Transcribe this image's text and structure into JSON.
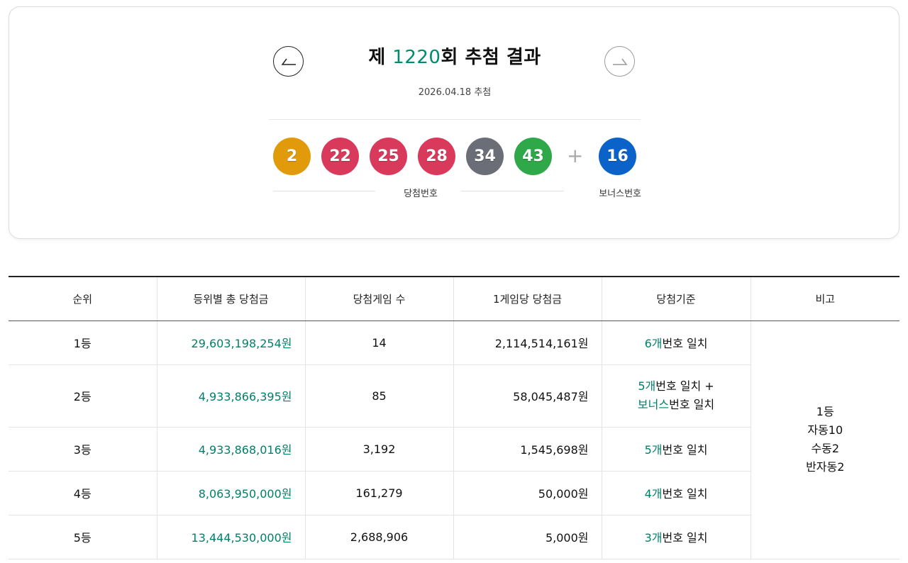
{
  "header": {
    "title_prefix": "제 ",
    "round": "1220",
    "title_suffix": "회 추첨 결과",
    "date": "2026.04.18 추첨",
    "prev_icon": "arrow-left-icon",
    "next_icon": "arrow-right-icon"
  },
  "balls": {
    "winning": [
      {
        "number": "2",
        "color": "#e09a0a"
      },
      {
        "number": "22",
        "color": "#d93a5b"
      },
      {
        "number": "25",
        "color": "#d93a5b"
      },
      {
        "number": "28",
        "color": "#d93a5b"
      },
      {
        "number": "34",
        "color": "#6b6e77"
      },
      {
        "number": "43",
        "color": "#2fa84a"
      }
    ],
    "plus": "+",
    "bonus": {
      "number": "16",
      "color": "#0b63c9"
    },
    "winning_label": "당첨번호",
    "bonus_label": "보너스번호"
  },
  "table": {
    "headers": [
      "순위",
      "등위별 총 당첨금",
      "당첨게임 수",
      "1게임당 당첨금",
      "당첨기준",
      "비고"
    ],
    "rows": [
      {
        "rank": "1등",
        "total": "29,603,198,254원",
        "count": "14",
        "per_game": "2,114,514,161원",
        "criteria_num": "6개",
        "criteria_text": "번호 일치"
      },
      {
        "rank": "2등",
        "total": "4,933,866,395원",
        "count": "85",
        "per_game": "58,045,487원",
        "criteria_num": "5개",
        "criteria_text": "번호 일치 +",
        "criteria_num2": "보너스",
        "criteria_text2": "번호 일치"
      },
      {
        "rank": "3등",
        "total": "4,933,868,016원",
        "count": "3,192",
        "per_game": "1,545,698원",
        "criteria_num": "5개",
        "criteria_text": "번호 일치"
      },
      {
        "rank": "4등",
        "total": "8,063,950,000원",
        "count": "161,279",
        "per_game": "50,000원",
        "criteria_num": "4개",
        "criteria_text": "번호 일치"
      },
      {
        "rank": "5등",
        "total": "13,444,530,000원",
        "count": "2,688,906",
        "per_game": "5,000원",
        "criteria_num": "3개",
        "criteria_text": "번호 일치"
      }
    ],
    "note_lines": [
      "1등",
      "자동10",
      "수동2",
      "반자동2"
    ]
  }
}
